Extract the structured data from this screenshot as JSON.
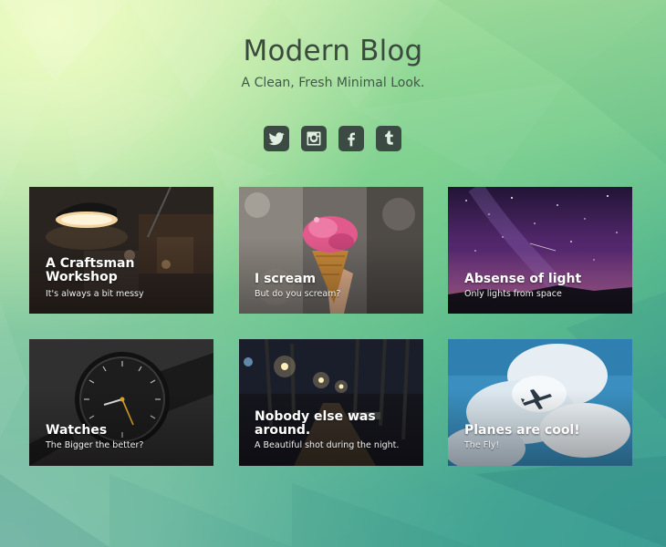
{
  "site": {
    "title": "Modern Blog",
    "tagline": "A Clean, Fresh Minimal Look."
  },
  "social": [
    {
      "name": "twitter-icon",
      "glyph": "twitter"
    },
    {
      "name": "instagram-icon",
      "glyph": "instagram"
    },
    {
      "name": "facebook-icon",
      "glyph": "facebook"
    },
    {
      "name": "tumblr-icon",
      "glyph": "tumblr"
    }
  ],
  "colors": {
    "title_text": "#3a4a3e",
    "icon_tile": "#3c4a44",
    "background_top": "#eefcc4",
    "background_bottom": "#3c9e94"
  },
  "posts": [
    {
      "title_line1": "A Craftsman",
      "title_line2": "Workshop",
      "subtitle": "It's always a bit messy"
    },
    {
      "title_line1": "I scream",
      "title_line2": "",
      "subtitle": "But do you scream?"
    },
    {
      "title_line1": "Absense of light",
      "title_line2": "",
      "subtitle": "Only lights from space"
    },
    {
      "title_line1": "Watches",
      "title_line2": "",
      "subtitle": "The Bigger the better?"
    },
    {
      "title_line1": "Nobody else was",
      "title_line2": "around.",
      "subtitle": "A Beautiful shot during the night."
    },
    {
      "title_line1": "Planes are cool!",
      "title_line2": "",
      "subtitle": "The Fly!"
    }
  ]
}
